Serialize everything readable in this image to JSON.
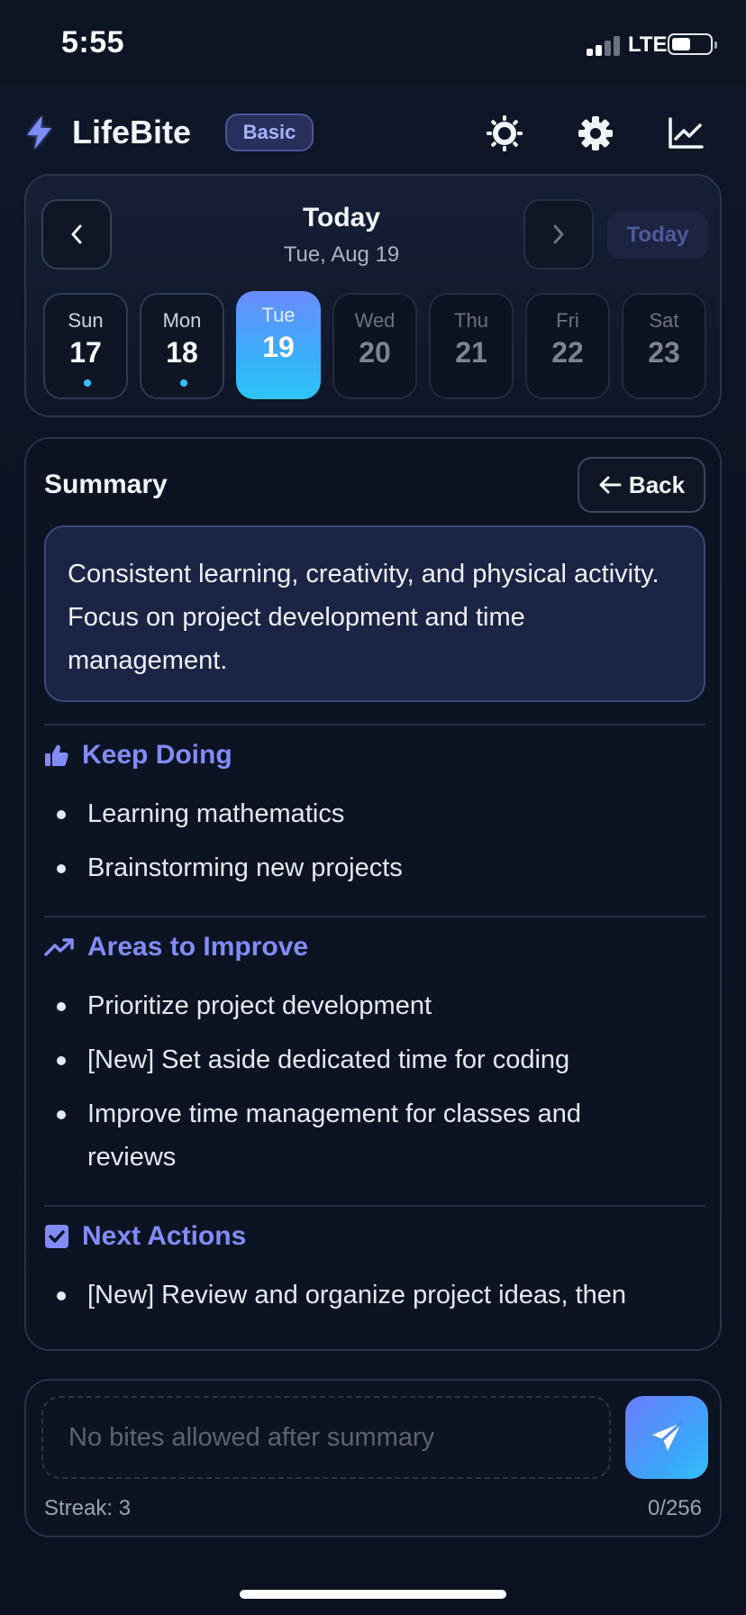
{
  "status_bar": {
    "time": "5:55",
    "network": "LTE"
  },
  "header": {
    "app_name": "LifeBite",
    "plan_badge": "Basic",
    "icons": [
      "bolt-icon",
      "sun-icon",
      "gear-icon",
      "chart-icon"
    ]
  },
  "calendar": {
    "title": "Today",
    "subtitle": "Tue, Aug 19",
    "today_label": "Today",
    "days": [
      {
        "name": "Sun",
        "num": "17"
      },
      {
        "name": "Mon",
        "num": "18"
      },
      {
        "name": "Tue",
        "num": "19"
      },
      {
        "name": "Wed",
        "num": "20"
      },
      {
        "name": "Thu",
        "num": "21"
      },
      {
        "name": "Fri",
        "num": "22"
      },
      {
        "name": "Sat",
        "num": "23"
      }
    ]
  },
  "summary": {
    "title": "Summary",
    "back_label": "Back",
    "text": "Consistent learning, creativity, and physical activity. Focus on project development and time management.",
    "sections": [
      {
        "title": "Keep Doing",
        "items": [
          "Learning mathematics",
          "Brainstorming new projects"
        ]
      },
      {
        "title": "Areas to Improve",
        "items": [
          "Prioritize project development",
          "[New] Set aside dedicated time for coding",
          "Improve time management for classes and reviews"
        ]
      },
      {
        "title": "Next Actions",
        "items": [
          "[New] Review and organize project ideas, then"
        ]
      }
    ]
  },
  "composer": {
    "placeholder": "No bites allowed after summary",
    "streak": "Streak: 3",
    "counter": "0/256"
  },
  "colors": {
    "accent": "#818cf8",
    "badge_bg": "#27305a",
    "dot": "#38bdf8"
  }
}
